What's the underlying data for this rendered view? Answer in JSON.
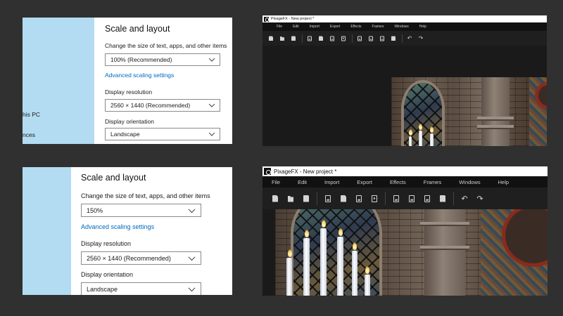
{
  "settings_small": {
    "sidebar": {
      "items": [
        "his PC",
        "nces"
      ]
    },
    "heading": "Scale and layout",
    "scale_label": "Change the size of text, apps, and other items",
    "scale_value": "100% (Recommended)",
    "advanced_link": "Advanced scaling settings",
    "resolution_label": "Display resolution",
    "resolution_value": "2560 × 1440 (Recommended)",
    "orientation_label": "Display orientation",
    "orientation_value": "Landscape"
  },
  "settings_large": {
    "heading": "Scale and layout",
    "scale_label": "Change the size of text, apps, and other items",
    "scale_value": "150%",
    "advanced_link": "Advanced scaling settings",
    "resolution_label": "Display resolution",
    "resolution_value": "2560 × 1440 (Recommended)",
    "orientation_label": "Display orientation",
    "orientation_value": "Landscape"
  },
  "pixagefx_small": {
    "title": "PixageFX - New project *",
    "menu": [
      "File",
      "Edit",
      "Import",
      "Export",
      "Effects",
      "Frames",
      "Windows",
      "Help"
    ]
  },
  "pixagefx_large": {
    "title": "PixageFX - New project *",
    "menu": [
      "File",
      "Edit",
      "Import",
      "Export",
      "Effects",
      "Frames",
      "Windows",
      "Help"
    ]
  },
  "toolbar_icons": [
    "new-file-icon",
    "open-folder-icon",
    "save-icon",
    "image-icon",
    "image-export-icon",
    "frames-icon",
    "film-icon",
    "image-effect-icon",
    "image-adjust-icon",
    "frame-icon",
    "save-frame-icon",
    "undo-icon",
    "redo-icon"
  ],
  "colors": {
    "background": "#303030",
    "sidebar": "#b3dcf2",
    "link": "#0067c0",
    "pixage_menubar": "#111111",
    "pixage_toolbar": "#1f1f1f"
  }
}
